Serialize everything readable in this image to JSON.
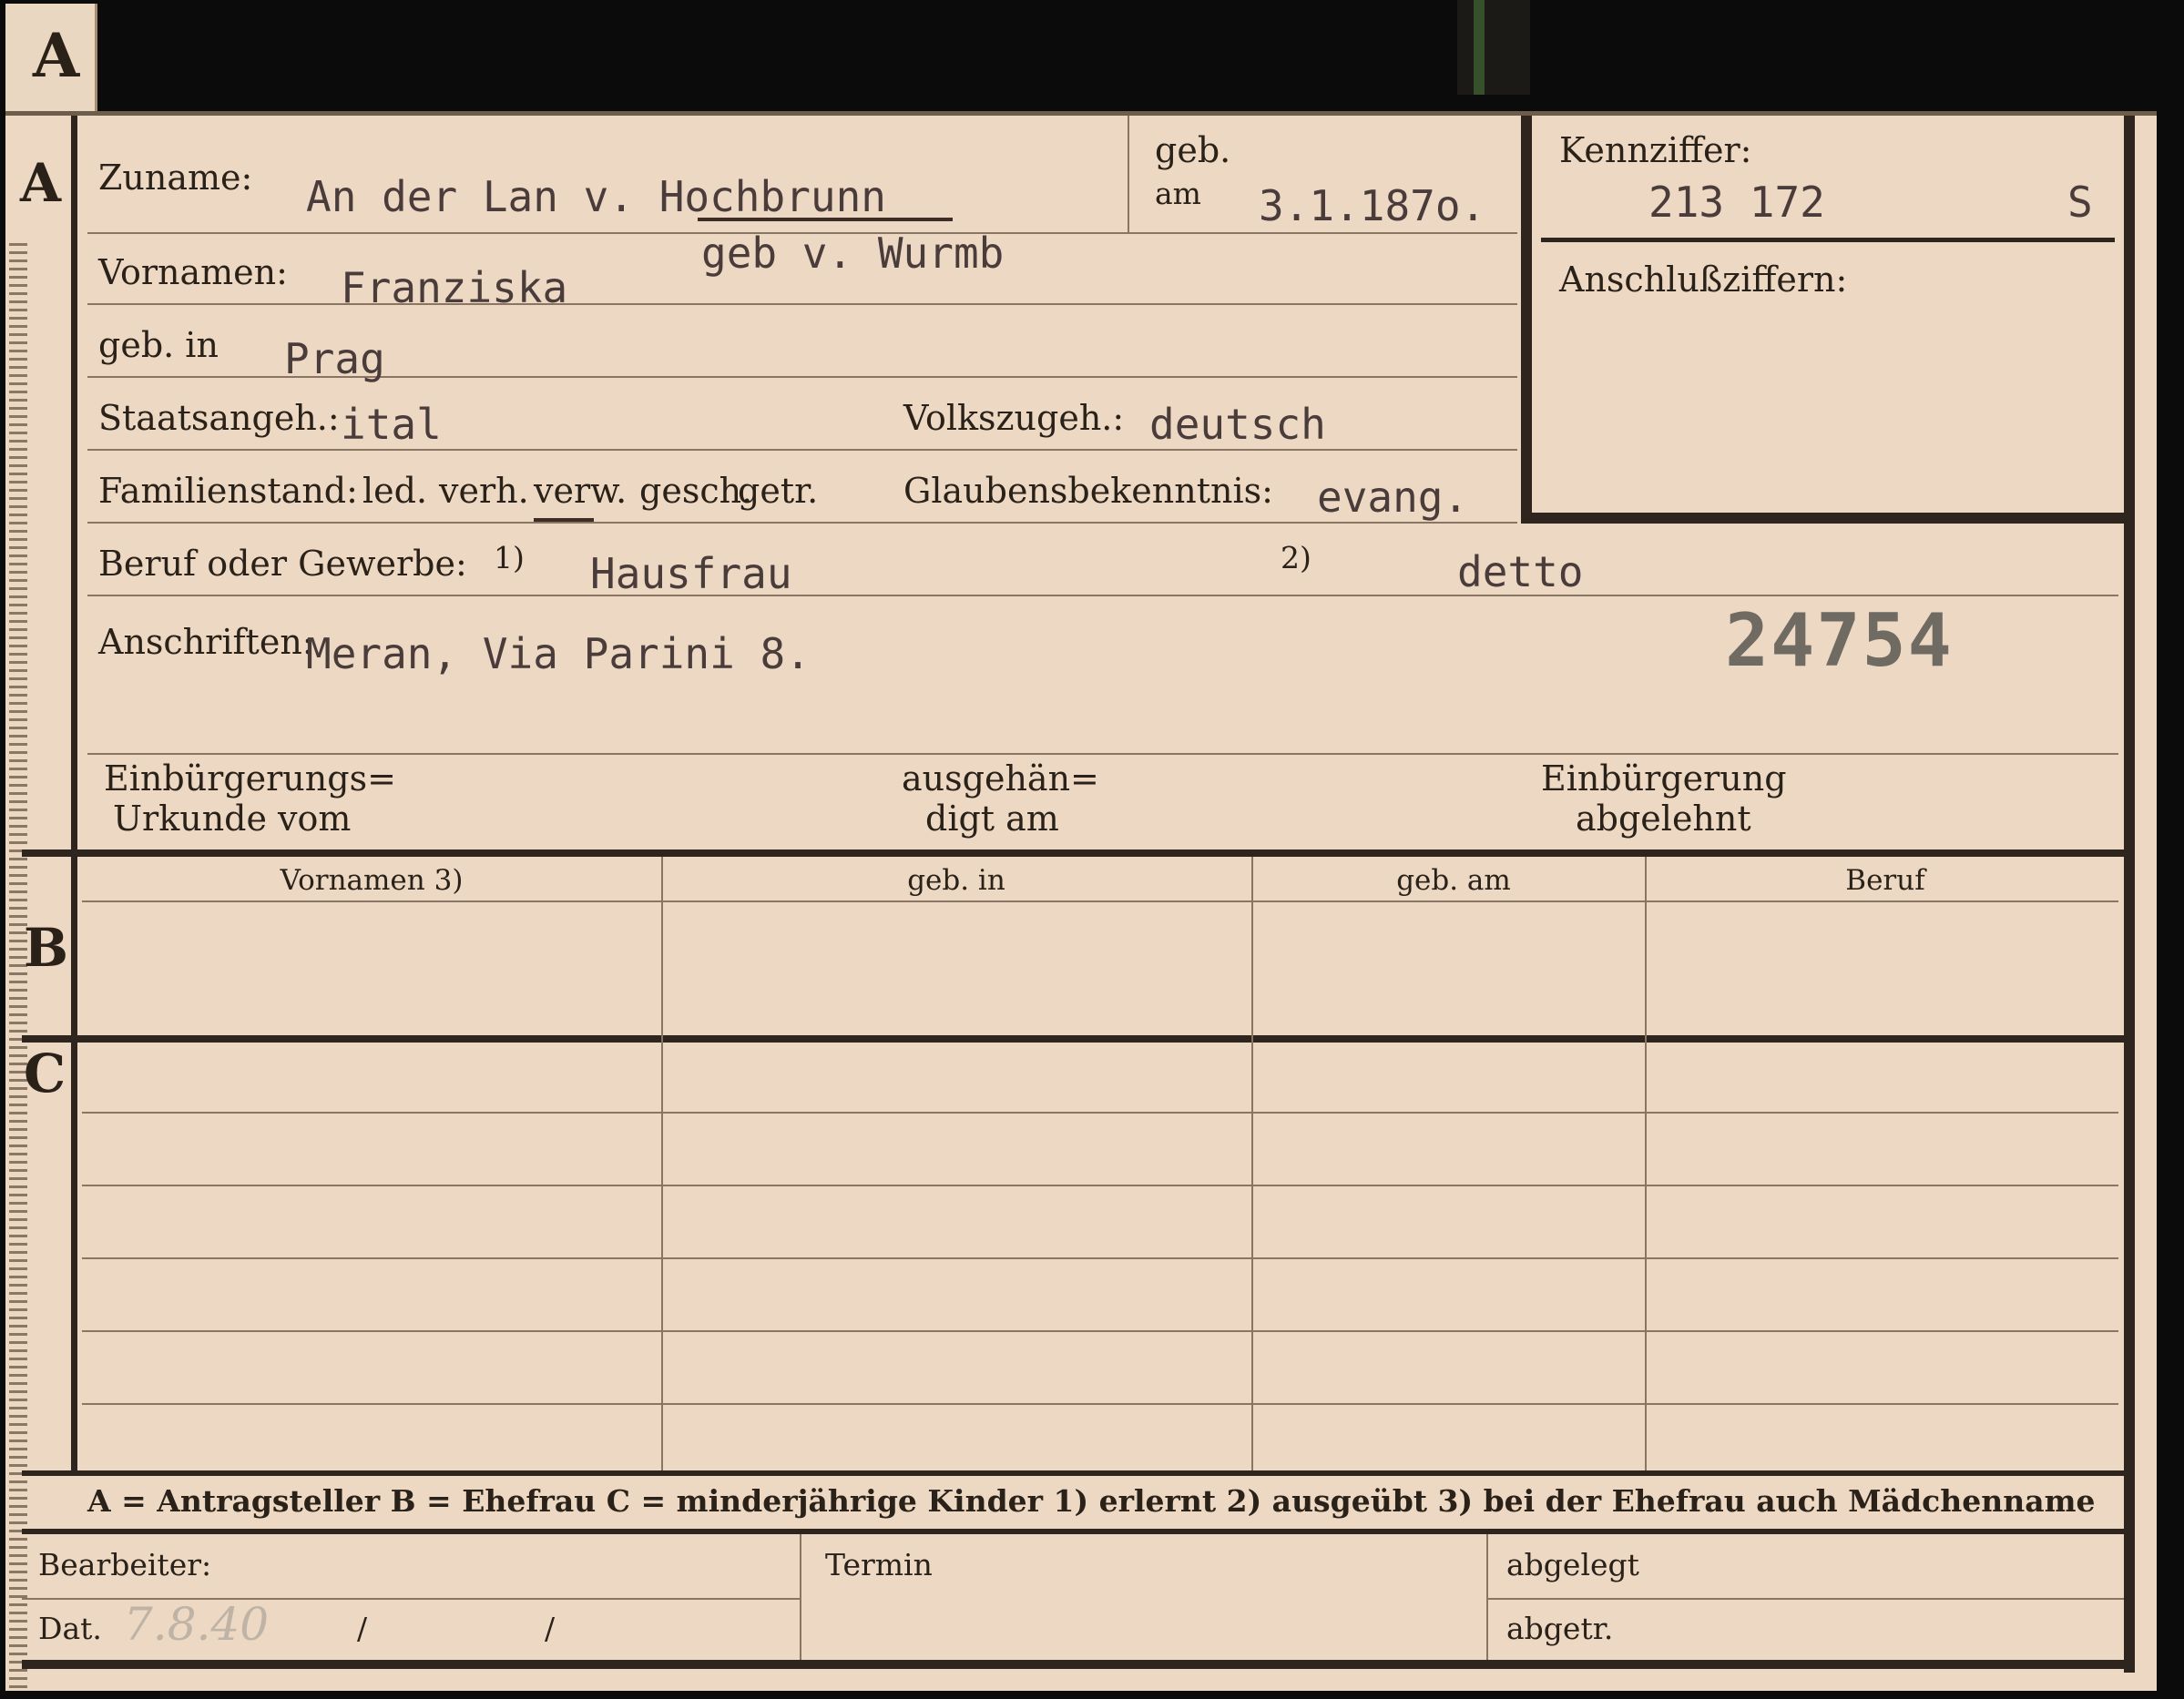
{
  "tab_letter": "A",
  "section_a": {
    "letter": "A",
    "zuname_label": "Zuname:",
    "zuname_value": "An der Lan v. Hochbrunn",
    "geb_am_label_1": "geb.",
    "geb_am_label_2": "am",
    "geb_am_value": "3.1.187o.",
    "kennziffer_label": "Kennziffer:",
    "kennziffer_value": "213 172",
    "kennziffer_suffix": "S",
    "anschluss_label": "Anschlußziffern:",
    "vornamen_label": "Vornamen:",
    "vornamen_value": "Franziska",
    "geb_name_value": "geb v. Wurmb",
    "geb_in_label": "geb. in",
    "geb_in_value": "Prag",
    "staatsangeh_label": "Staatsangeh.:",
    "staatsangeh_value": "ital",
    "volkszugeh_label": "Volkszugeh.:",
    "volkszugeh_value": "deutsch",
    "familienstand_label": "Familienstand:",
    "familienstand_options": [
      "led.",
      "verh.",
      "verw.",
      "gesch.",
      "getr."
    ],
    "glauben_label": "Glaubensbekenntnis:",
    "glauben_value": "evang.",
    "beruf_label": "Beruf oder Gewerbe:",
    "beruf_note1": "1)",
    "beruf_value1": "Hausfrau",
    "beruf_note2": "2)",
    "beruf_value2": "detto",
    "anschriften_label": "Anschriften:",
    "anschriften_value": "Meran, Via Parini 8.",
    "stamp_number": "24754",
    "einb_urkunde_1": "Einbürgerungs=",
    "einb_urkunde_2": "Urkunde vom",
    "ausgehaendigt_1": "ausgehän=",
    "ausgehaendigt_2": "digt am",
    "einb_abgelehnt_1": "Einbürgerung",
    "einb_abgelehnt_2": "abgelehnt"
  },
  "section_b": {
    "letter": "B",
    "columns": [
      "Vornamen 3)",
      "geb. in",
      "geb. am",
      "Beruf"
    ]
  },
  "section_c": {
    "letter": "C"
  },
  "legend": "A = Antragsteller   B = Ehefrau   C = minderjährige Kinder   1) erlernt   2) ausgeübt   3) bei der Ehefrau auch Mädchenname",
  "footer": {
    "bearbeiter_label": "Bearbeiter:",
    "dat_label": "Dat.",
    "dat_value": "7.8.40",
    "slash": "/",
    "termin_label": "Termin",
    "abgelegt_label": "abgelegt",
    "abgetr_label": "abgetr."
  }
}
